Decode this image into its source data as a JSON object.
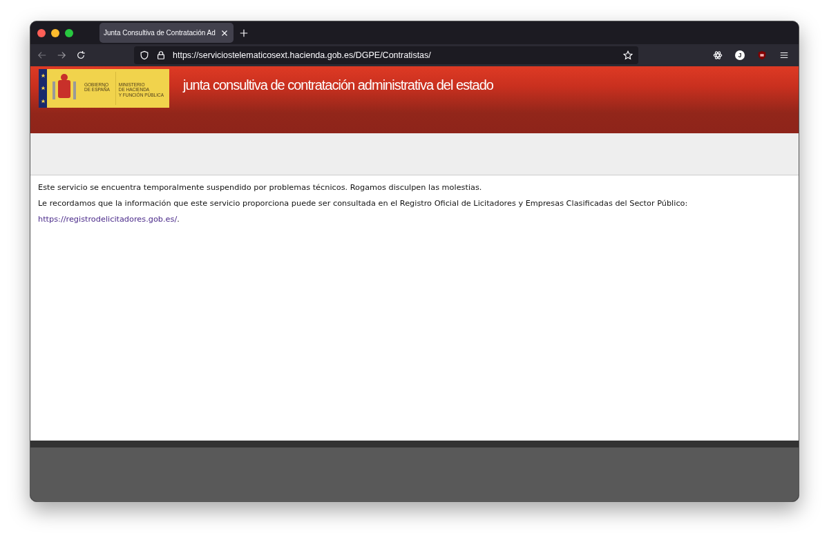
{
  "tabs": [
    {
      "label": "Junta Consultiva de Contratación Ad",
      "selected": true
    }
  ],
  "address_bar": {
    "url": "https://serviciostelematicosext.hacienda.gob.es/DGPE/Contratistas/"
  },
  "extensions": [
    {
      "kind": "atom"
    },
    {
      "kind": "letter",
      "label": "J"
    },
    {
      "kind": "shield"
    }
  ],
  "header": {
    "logo": {
      "government": "GOBIERNO\nDE ESPAÑA",
      "ministry": "MINISTERIO\nDE HACIENDA\nY FUNCIÓN PÚBLICA"
    },
    "title": "junta consultiva de contratación administrativa del estado"
  },
  "content": {
    "paragraphs": [
      {
        "text": "Este servicio se encuentra temporalmente suspendido por problemas técnicos. Rogamos disculpen las molestias."
      },
      {
        "text": "Le recordamos que la información que este servicio proporciona puede ser consultada en el Registro Oficial de Licitadores y Empresas Clasificadas del Sector Público:"
      },
      {
        "link": "https://registrodelicitadores.gob.es/",
        "after": "."
      }
    ]
  }
}
